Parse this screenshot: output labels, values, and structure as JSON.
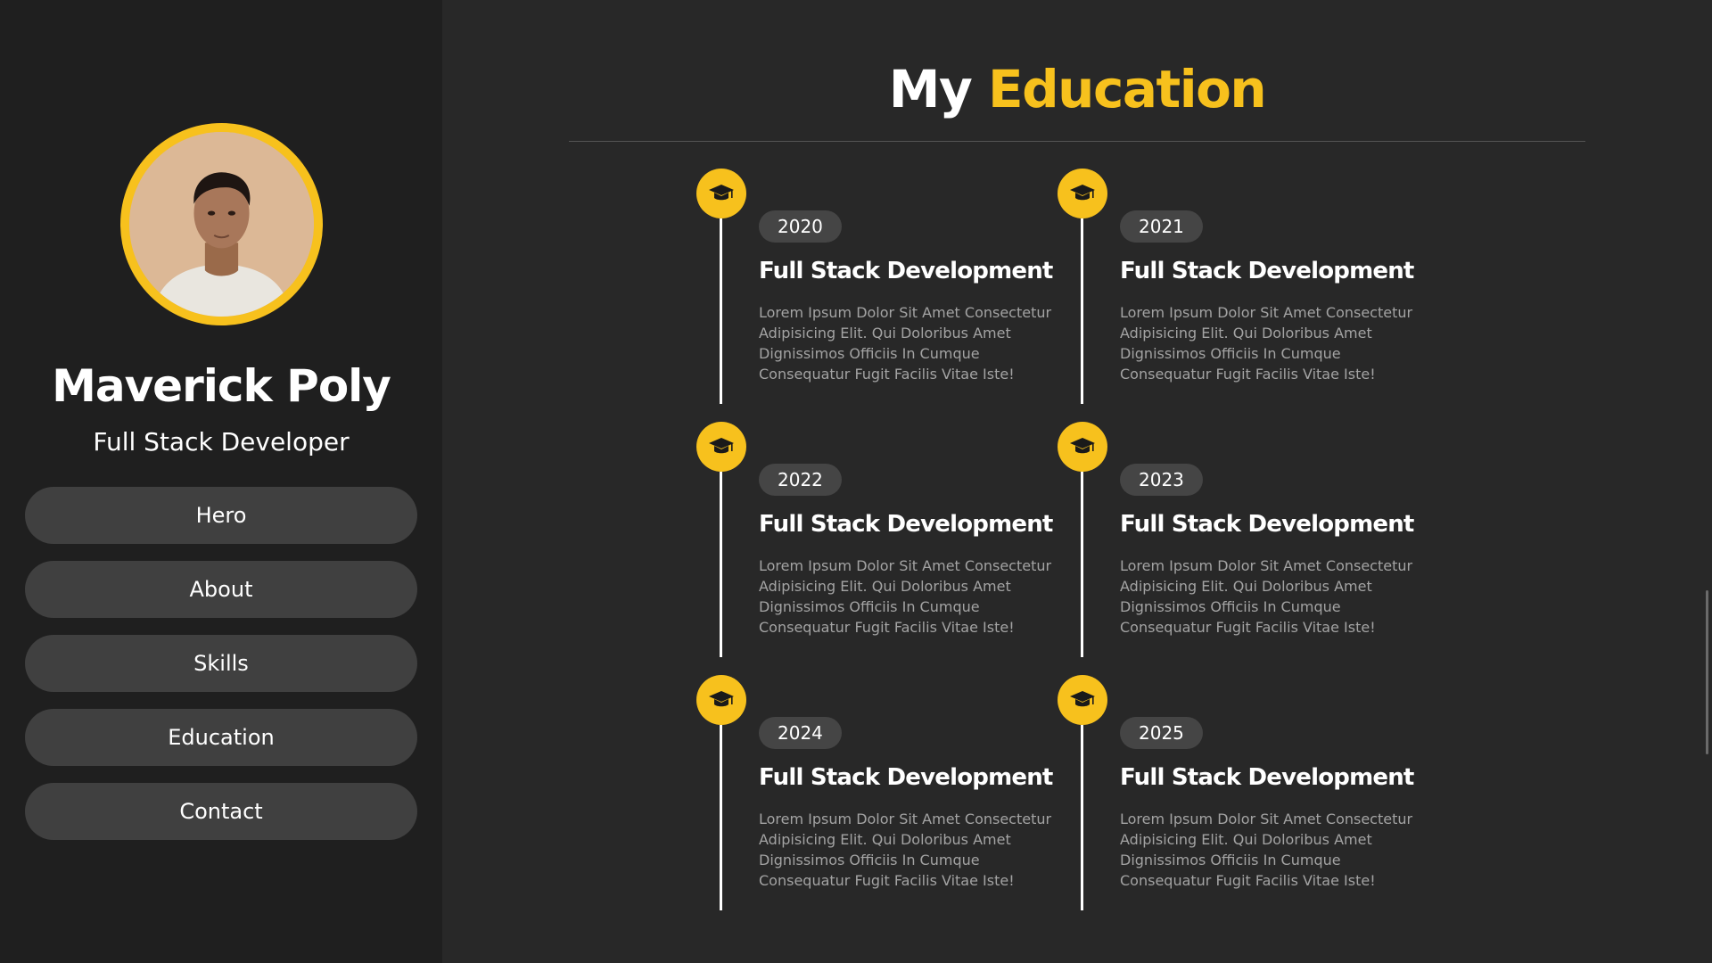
{
  "profile": {
    "name": "Maverick Poly",
    "role": "Full Stack Developer"
  },
  "nav": {
    "items": [
      {
        "label": "Hero"
      },
      {
        "label": "About"
      },
      {
        "label": "Skills"
      },
      {
        "label": "Education"
      },
      {
        "label": "Contact"
      }
    ]
  },
  "education": {
    "title_prefix": "My",
    "title_accent": "Education",
    "items": [
      {
        "year": "2020",
        "title": "Full Stack Development",
        "description": "Lorem Ipsum Dolor Sit Amet Consectetur Adipisicing Elit. Qui Doloribus Amet Dignissimos Officiis In Cumque Consequatur Fugit Facilis Vitae Iste!"
      },
      {
        "year": "2021",
        "title": "Full Stack Development",
        "description": "Lorem Ipsum Dolor Sit Amet Consectetur Adipisicing Elit. Qui Doloribus Amet Dignissimos Officiis In Cumque Consequatur Fugit Facilis Vitae Iste!"
      },
      {
        "year": "2022",
        "title": "Full Stack Development",
        "description": "Lorem Ipsum Dolor Sit Amet Consectetur Adipisicing Elit. Qui Doloribus Amet Dignissimos Officiis In Cumque Consequatur Fugit Facilis Vitae Iste!"
      },
      {
        "year": "2023",
        "title": "Full Stack Development",
        "description": "Lorem Ipsum Dolor Sit Amet Consectetur Adipisicing Elit. Qui Doloribus Amet Dignissimos Officiis In Cumque Consequatur Fugit Facilis Vitae Iste!"
      },
      {
        "year": "2024",
        "title": "Full Stack Development",
        "description": "Lorem Ipsum Dolor Sit Amet Consectetur Adipisicing Elit. Qui Doloribus Amet Dignissimos Officiis In Cumque Consequatur Fugit Facilis Vitae Iste!"
      },
      {
        "year": "2025",
        "title": "Full Stack Development",
        "description": "Lorem Ipsum Dolor Sit Amet Consectetur Adipisicing Elit. Qui Doloribus Amet Dignissimos Officiis In Cumque Consequatur Fugit Facilis Vitae Iste!"
      }
    ]
  },
  "icons": {
    "timeline": "graduation-cap-icon"
  },
  "colors": {
    "accent": "#f7c11d",
    "background": "#282828",
    "sidebar": "#1f1f1f",
    "button": "#404040",
    "muted_text": "#a3a3a3"
  }
}
